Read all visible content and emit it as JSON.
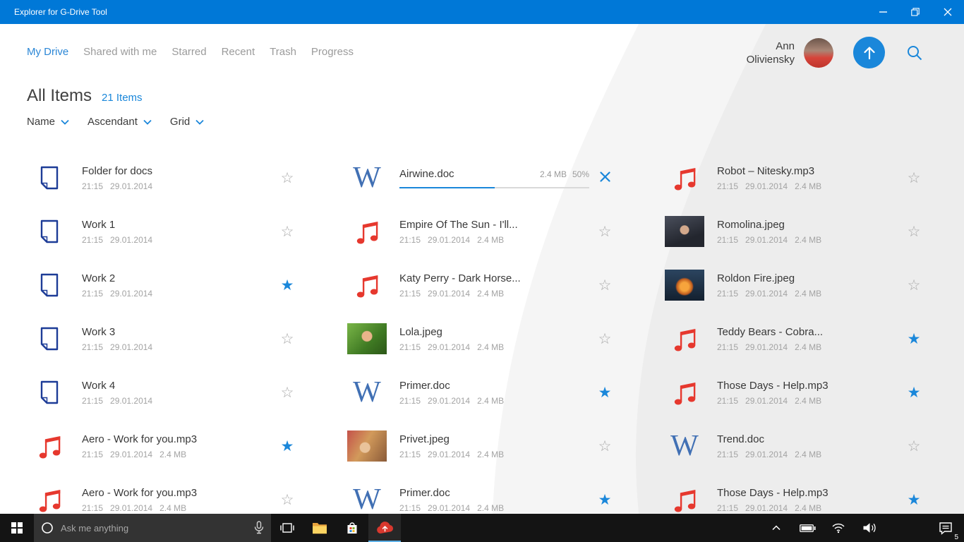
{
  "titlebar": {
    "title": "Explorer for G-Drive Tool"
  },
  "nav": {
    "items": [
      {
        "label": "My Drive",
        "active": true
      },
      {
        "label": "Shared with me",
        "active": false
      },
      {
        "label": "Starred",
        "active": false
      },
      {
        "label": "Recent",
        "active": false
      },
      {
        "label": "Trash",
        "active": false
      },
      {
        "label": "Progress",
        "active": false
      }
    ]
  },
  "user": {
    "name_line1": "Ann",
    "name_line2": "Oliviensky"
  },
  "header": {
    "title": "All Items",
    "count": "21 Items"
  },
  "sort": {
    "controls": [
      {
        "label": "Name"
      },
      {
        "label": "Ascendant"
      },
      {
        "label": "Grid"
      }
    ]
  },
  "grid": {
    "columns": [
      {
        "items": [
          {
            "type": "doc",
            "title": "Folder for docs",
            "time": "21:15",
            "date": "29.01.2014",
            "starred": false
          },
          {
            "type": "doc",
            "title": "Work 1",
            "time": "21:15",
            "date": "29.01.2014",
            "starred": false
          },
          {
            "type": "doc",
            "title": "Work 2",
            "time": "21:15",
            "date": "29.01.2014",
            "starred": true
          },
          {
            "type": "doc",
            "title": "Work 3",
            "time": "21:15",
            "date": "29.01.2014",
            "starred": false
          },
          {
            "type": "doc",
            "title": "Work 4",
            "time": "21:15",
            "date": "29.01.2014",
            "starred": false
          },
          {
            "type": "music",
            "title": "Aero - Work for you.mp3",
            "time": "21:15",
            "date": "29.01.2014",
            "size": "2.4 MB",
            "starred": true
          },
          {
            "type": "music",
            "title": "Aero - Work for you.mp3",
            "time": "21:15",
            "date": "29.01.2014",
            "size": "2.4 MB",
            "starred": false
          }
        ]
      },
      {
        "items": [
          {
            "type": "word",
            "title": "Airwine.doc",
            "progress": {
              "size": "2.4 MB",
              "percent": "50%",
              "value": 50
            }
          },
          {
            "type": "music",
            "title": "Empire Of The Sun - I'll...",
            "time": "21:15",
            "date": "29.01.2014",
            "size": "2.4 MB",
            "starred": false
          },
          {
            "type": "music",
            "title": "Katy Perry - Dark Horse...",
            "time": "21:15",
            "date": "29.01.2014",
            "size": "2.4 MB",
            "starred": false
          },
          {
            "type": "image",
            "thumb": "lola",
            "title": "Lola.jpeg",
            "time": "21:15",
            "date": "29.01.2014",
            "size": "2.4 MB",
            "starred": false
          },
          {
            "type": "word",
            "title": "Primer.doc",
            "time": "21:15",
            "date": "29.01.2014",
            "size": "2.4 MB",
            "starred": true
          },
          {
            "type": "image",
            "thumb": "privet",
            "title": "Privet.jpeg",
            "time": "21:15",
            "date": "29.01.2014",
            "size": "2.4 MB",
            "starred": false
          },
          {
            "type": "word",
            "title": "Primer.doc",
            "time": "21:15",
            "date": "29.01.2014",
            "size": "2.4 MB",
            "starred": true
          }
        ]
      },
      {
        "items": [
          {
            "type": "music",
            "title": "Robot – Nitesky.mp3",
            "time": "21:15",
            "date": "29.01.2014",
            "size": "2.4 MB",
            "starred": false
          },
          {
            "type": "image",
            "thumb": "romolina",
            "title": "Romolina.jpeg",
            "time": "21:15",
            "date": "29.01.2014",
            "size": "2.4 MB",
            "starred": false
          },
          {
            "type": "image",
            "thumb": "roldon",
            "title": "Roldon Fire.jpeg",
            "time": "21:15",
            "date": "29.01.2014",
            "size": "2.4 MB",
            "starred": false
          },
          {
            "type": "music",
            "title": "Teddy Bears - Cobra...",
            "time": "21:15",
            "date": "29.01.2014",
            "size": "2.4 MB",
            "starred": true
          },
          {
            "type": "music",
            "title": "Those Days - Help.mp3",
            "time": "21:15",
            "date": "29.01.2014",
            "size": "2.4 MB",
            "starred": true
          },
          {
            "type": "word",
            "title": "Trend.doc",
            "time": "21:15",
            "date": "29.01.2014",
            "size": "2.4 MB",
            "starred": false
          },
          {
            "type": "music",
            "title": "Those Days - Help.mp3",
            "time": "21:15",
            "date": "29.01.2014",
            "size": "2.4 MB",
            "starred": true
          }
        ]
      }
    ]
  },
  "taskbar": {
    "search_placeholder": "Ask me anything",
    "notification_badge": "5"
  },
  "colors": {
    "titlebar": "#0078d7",
    "accent": "#1a87da",
    "music_icon": "#e6382e",
    "doc_icon": "#1d3c97",
    "word_icon": "#4170b4",
    "star_outline": "#a9a9a9",
    "star_filled": "#1a87da",
    "taskbar_bg": "#141414",
    "app_cloud": "#d8382e"
  }
}
